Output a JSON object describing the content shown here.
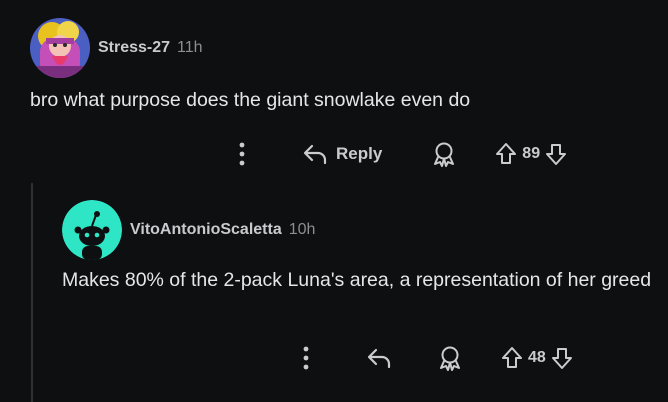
{
  "comments": [
    {
      "username": "Stress-27",
      "timestamp": "11h",
      "body": "bro what purpose does the giant snowlake even do",
      "actions": {
        "reply_label": "Reply",
        "score": "89"
      },
      "avatar_icon": "stress-27-avatar"
    },
    {
      "username": "VitoAntonioScaletta",
      "timestamp": "10h",
      "body": "Makes 80% of the 2-pack Luna's area, a representation of her greed",
      "actions": {
        "score": "48"
      },
      "avatar_icon": "default-snoo-avatar"
    }
  ],
  "colors": {
    "background": "#0d0f11",
    "avatar_teal": "#2ee6c5",
    "text": "#e4e6e8",
    "muted": "#8b8f92"
  }
}
